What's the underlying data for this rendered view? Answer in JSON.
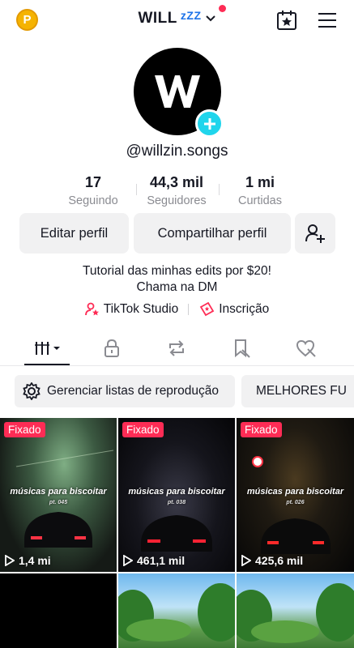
{
  "topbar": {
    "coin_letter": "P",
    "account_name": "WILL",
    "account_suffix": "zZZ",
    "icons": [
      "coin-icon",
      "chevron-down-icon",
      "calendar-star-icon",
      "menu-icon"
    ]
  },
  "profile": {
    "handle": "@willzin.songs",
    "stats": [
      {
        "value": "17",
        "label": "Seguindo"
      },
      {
        "value": "44,3 mil",
        "label": "Seguidores"
      },
      {
        "value": "1 mi",
        "label": "Curtidas"
      }
    ],
    "edit_label": "Editar perfil",
    "share_label": "Compartilhar perfil",
    "bio_line1": "Tutorial das minhas edits por $20!",
    "bio_line2": "Chama na DM",
    "link1": "TikTok Studio",
    "link2": "Inscrição"
  },
  "chips": {
    "playlists": "Gerenciar listas de reprodução",
    "second": "MELHORES FU"
  },
  "videos": [
    {
      "pinned": "Fixado",
      "views": "1,4 mi",
      "title": "músicas para biscoitar",
      "sub": "pt. 045"
    },
    {
      "pinned": "Fixado",
      "views": "461,1 mil",
      "title": "músicas para biscoitar",
      "sub": "pt. 038"
    },
    {
      "pinned": "Fixado",
      "views": "425,6 mil",
      "title": "músicas para biscoitar",
      "sub": "pt. 026"
    }
  ],
  "colors": {
    "accent": "#fe2c55",
    "add": "#20d5ec",
    "zz": "#1e73e8"
  }
}
